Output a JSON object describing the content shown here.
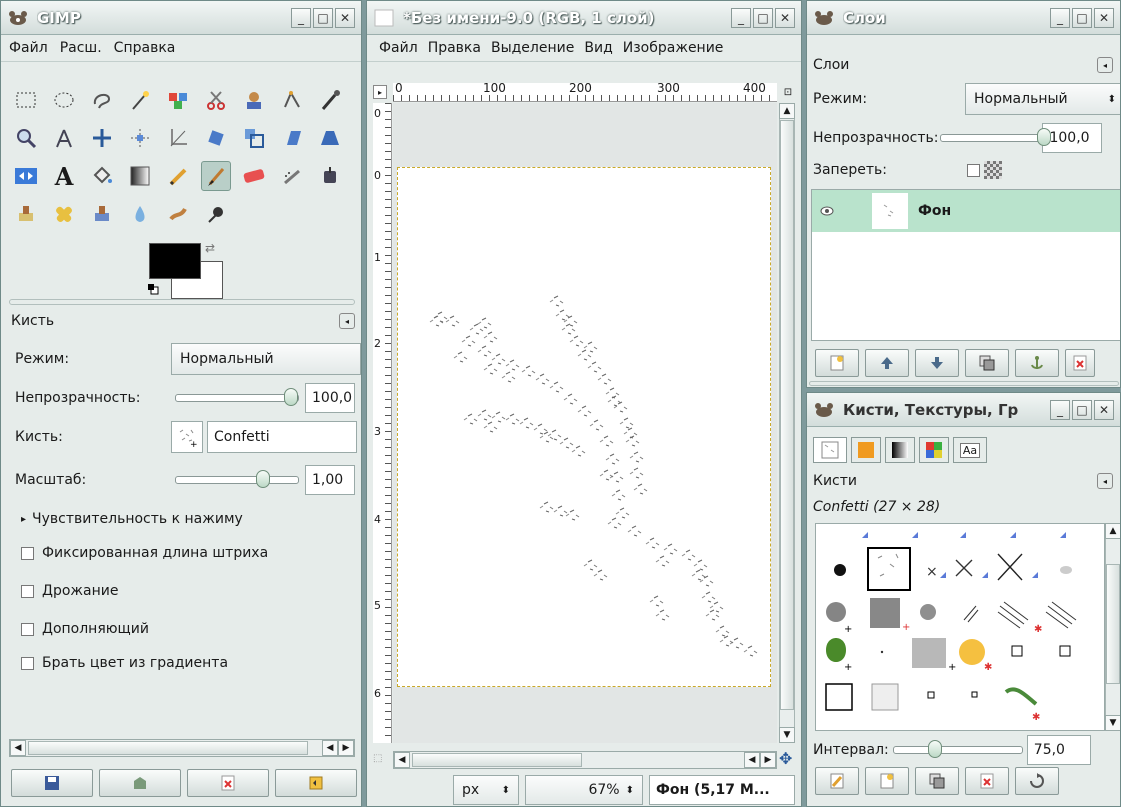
{
  "toolbox": {
    "title": "GIMP",
    "menu": {
      "file": "Файл",
      "ext": "Расш.",
      "help": "Справка"
    },
    "tool_options_title": "Кисть",
    "mode_label": "Режим:",
    "mode_value": "Нормальный",
    "opacity_label": "Непрозрачность:",
    "opacity_value": "100,0",
    "opacity_level": 1.0,
    "brush_label": "Кисть:",
    "brush_value": "Confetti",
    "scale_label": "Масштаб:",
    "scale_value": "1,00",
    "sensitivity_label": "Чувствительность к нажиму",
    "fixed_length_label": "Фиксированная длина штриха",
    "jitter_label": "Дрожание",
    "incremental_label": "Дополняющий",
    "gradient_color_label": "Брать цвет из градиента",
    "fg_color": "#000000",
    "bg_color": "#ffffff"
  },
  "image_window": {
    "title": "*Без имени-9.0 (RGB, 1 слой)",
    "menu": {
      "file": "Файл",
      "edit": "Правка",
      "select": "Выделение",
      "view": "Вид",
      "image": "Изображение"
    },
    "ruler_top": [
      "0",
      "100",
      "200",
      "300",
      "400"
    ],
    "ruler_left": [
      "0",
      "1",
      "2",
      "3",
      "4",
      "5",
      "6"
    ],
    "unit": "px",
    "zoom": "67%",
    "status": "Фон (5,17 М..."
  },
  "layers": {
    "title": "Слои",
    "panel_label": "Слои",
    "mode_label": "Режим:",
    "mode_value": "Нормальный",
    "opacity_label": "Непрозрачность:",
    "opacity_value": "100,0",
    "lock_label": "Запереть:",
    "layer_name": "Фон"
  },
  "brushes": {
    "title": "Кисти, Текстуры, Гр",
    "panel_label": "Кисти",
    "brush_info": "Confetti (27 × 28)",
    "spacing_label": "Интервал:",
    "spacing_value": "75,0",
    "aa_label": "Aa"
  },
  "colors": {
    "accent": "#b9e3cc",
    "titlebar": "#d3dddb",
    "panel": "#e6ecea"
  }
}
